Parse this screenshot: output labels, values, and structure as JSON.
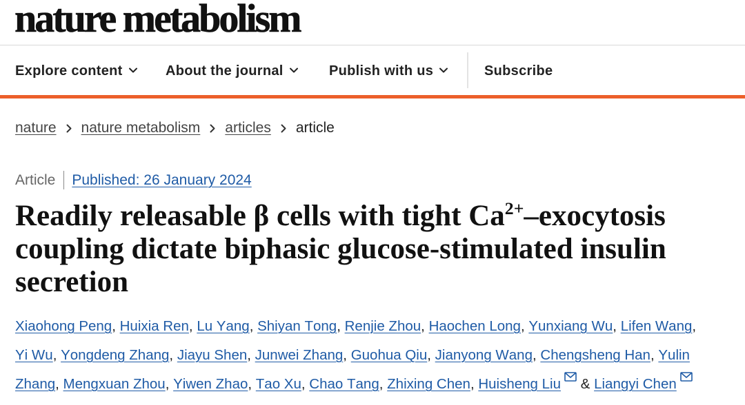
{
  "journal": {
    "name": "nature metabolism"
  },
  "nav": {
    "items": [
      {
        "label": "Explore content",
        "dropdown": true
      },
      {
        "label": "About the journal",
        "dropdown": true
      },
      {
        "label": "Publish with us",
        "dropdown": true
      }
    ],
    "subscribe_label": "Subscribe"
  },
  "breadcrumb": [
    {
      "label": "nature",
      "link": true
    },
    {
      "label": "nature metabolism",
      "link": true
    },
    {
      "label": "articles",
      "link": true
    },
    {
      "label": "article",
      "link": false
    }
  ],
  "article": {
    "type": "Article",
    "published_label": "Published:",
    "published_date": "26 January 2024",
    "title": {
      "before": "Readily releasable β cells with tight Ca",
      "superscript": "2+",
      "after": "–exocytosis coupling dictate biphasic glucose-stimulated insulin secretion"
    },
    "authors": [
      {
        "name": "Xiaohong Peng"
      },
      {
        "name": "Huixia Ren"
      },
      {
        "name": "Lu Yang"
      },
      {
        "name": "Shiyan Tong"
      },
      {
        "name": "Renjie Zhou"
      },
      {
        "name": "Haochen Long"
      },
      {
        "name": "Yunxiang Wu"
      },
      {
        "name": "Lifen Wang"
      },
      {
        "name": "Yi Wu"
      },
      {
        "name": "Yongdeng Zhang"
      },
      {
        "name": "Jiayu Shen"
      },
      {
        "name": "Junwei Zhang"
      },
      {
        "name": "Guohua Qiu"
      },
      {
        "name": "Jianyong Wang"
      },
      {
        "name": "Chengsheng Han"
      },
      {
        "name": "Yulin Zhang"
      },
      {
        "name": "Mengxuan Zhou"
      },
      {
        "name": "Yiwen Zhao"
      },
      {
        "name": "Tao Xu"
      },
      {
        "name": "Chao Tang"
      },
      {
        "name": "Zhixing Chen"
      },
      {
        "name": "Huisheng Liu",
        "corresponding": true
      },
      {
        "name": "Liangyi Chen",
        "corresponding": true
      }
    ],
    "author_separator": ",",
    "author_final_conjunction": "&"
  },
  "icons": {
    "nav_dropdown": "chevron-down-icon",
    "breadcrumb_separator": "chevron-right-icon",
    "corresponding_author": "envelope-icon"
  },
  "colors": {
    "accent": "#ec5f2a",
    "link": "#1f5ba6",
    "text": "#111111"
  }
}
